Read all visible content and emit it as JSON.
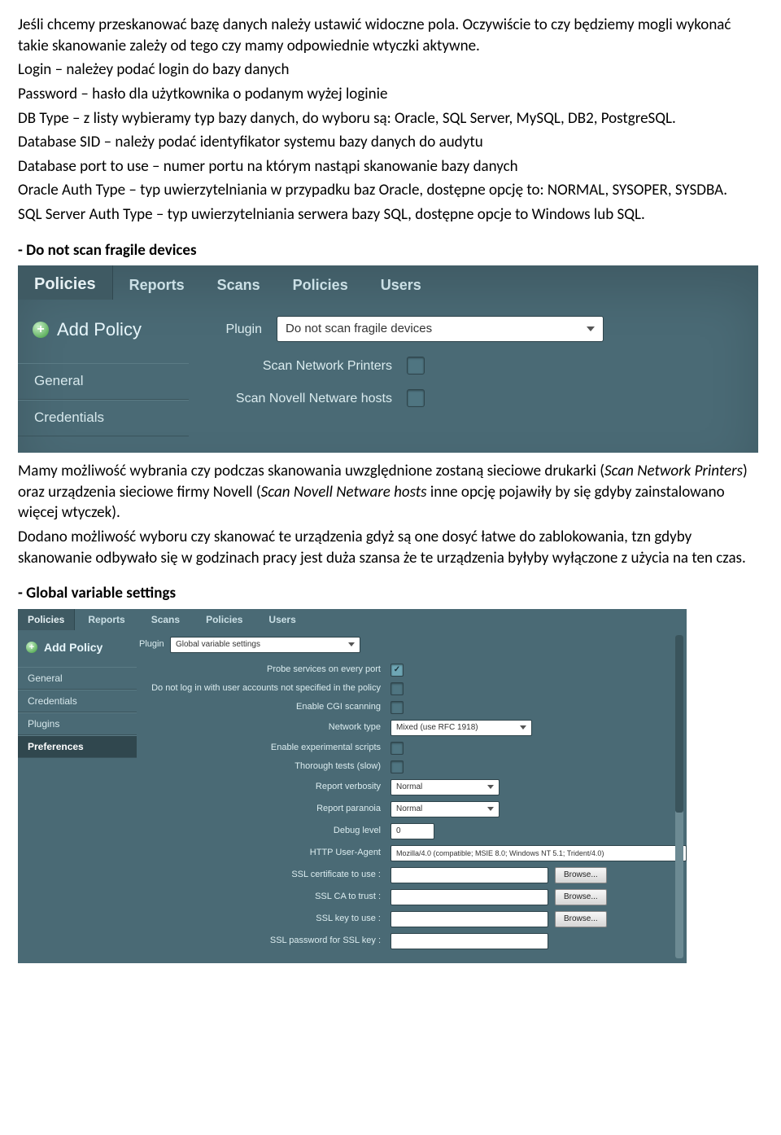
{
  "doc": {
    "p1": "Jeśli chcemy przeskanować bazę danych należy ustawić widoczne pola. Oczywiście to czy będziemy mogli wykonać takie skanowanie zależy od tego czy mamy odpowiednie wtyczki aktywne.",
    "p2": "Login – należey podać login do bazy danych",
    "p3": "Password – hasło dla użytkownika o podanym wyżej loginie",
    "p4": "DB Type – z listy wybieramy typ bazy danych, do wyboru są: Oracle, SQL Server, MySQL, DB2, PostgreSQL.",
    "p5": "Database SID – należy podać identyfikator systemu bazy danych do audytu",
    "p6": "Database port to use – numer portu na którym nastąpi skanowanie bazy danych",
    "p7": "Oracle Auth Type – typ uwierzytelniania w przypadku baz Oracle, dostępne opcję to: NORMAL, SYSOPER, SYSDBA.",
    "p8": "SQL Server Auth Type – typ uwierzytelniania serwera bazy SQL, dostępne opcje to Windows lub SQL.",
    "h1": "- Do not scan fragile devices",
    "p9a": "Mamy możliwość wybrania czy podczas skanowania uwzględnione zostaną sieciowe drukarki (",
    "p9b": "Scan Network Printers",
    "p9c": ") oraz urządzenia sieciowe firmy Novell (",
    "p9d": "Scan Novell Netware hosts",
    "p9e": " inne opcję pojawiły by się gdyby zainstalowano więcej wtyczek).",
    "p10": "Dodano możliwość wyboru czy skanować te urządzenia gdyż są one dosyć łatwe do zablokowania, tzn gdyby skanowanie odbywało się w godzinach pracy jest duża szansa że te urządzenia byłyby wyłączone z użycia na ten czas.",
    "h2": "- Global variable settings"
  },
  "shot1": {
    "tab": "Policies",
    "nav": [
      "Reports",
      "Scans",
      "Policies",
      "Users"
    ],
    "add": "Add Policy",
    "cats": [
      "General",
      "Credentials"
    ],
    "plugin_label": "Plugin",
    "plugin_value": "Do not scan fragile devices",
    "opts": [
      "Scan Network Printers",
      "Scan Novell Netware hosts"
    ]
  },
  "shot2": {
    "tab": "Policies",
    "nav": [
      "Reports",
      "Scans",
      "Policies",
      "Users"
    ],
    "add": "Add Policy",
    "cats": [
      "General",
      "Credentials",
      "Plugins",
      "Preferences"
    ],
    "plugin_label": "Plugin",
    "plugin_value": "Global variable settings",
    "rows": {
      "probe": "Probe services on every port",
      "nolog": "Do not log in with user accounts not specified in the policy",
      "cgi": "Enable CGI scanning",
      "nettype": "Network type",
      "nettype_val": "Mixed (use RFC 1918)",
      "exp": "Enable experimental scripts",
      "thor": "Thorough tests (slow)",
      "verb": "Report verbosity",
      "verb_val": "Normal",
      "para": "Report paranoia",
      "para_val": "Normal",
      "debug": "Debug level",
      "debug_val": "0",
      "ua": "HTTP User-Agent",
      "ua_val": "Mozilla/4.0 (compatible; MSIE 8.0; Windows NT 5.1; Trident/4.0)",
      "sslcert": "SSL certificate to use :",
      "sslca": "SSL CA to trust :",
      "sslkey": "SSL key to use :",
      "sslpass": "SSL password for SSL key :",
      "browse": "Browse..."
    }
  }
}
